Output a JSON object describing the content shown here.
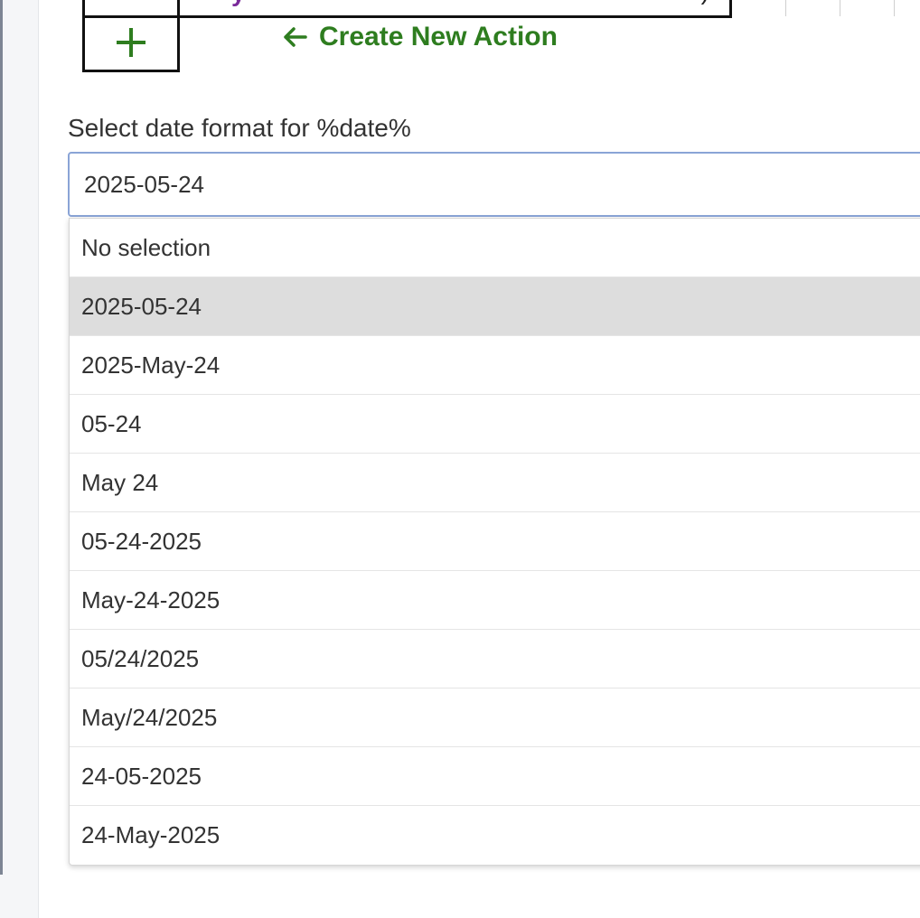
{
  "actions": {
    "create_new_action_label": "Create New Action"
  },
  "date_format": {
    "label": "Select date format for %date%",
    "selected_value": "2025-05-24",
    "options": [
      "No selection",
      "2025-05-24",
      "2025-May-24",
      "05-24",
      "May 24",
      "05-24-2025",
      "May-24-2025",
      "05/24/2025",
      "May/24/2025",
      "24-05-2025",
      "24-May-2025"
    ],
    "highlighted_index": 1
  },
  "colors": {
    "accent_green": "#2e7d1f",
    "select_border": "#8aa4d6",
    "highlight": "#dddddd"
  },
  "icons": {
    "add": "plus-icon",
    "create": "arrow-left-icon"
  }
}
